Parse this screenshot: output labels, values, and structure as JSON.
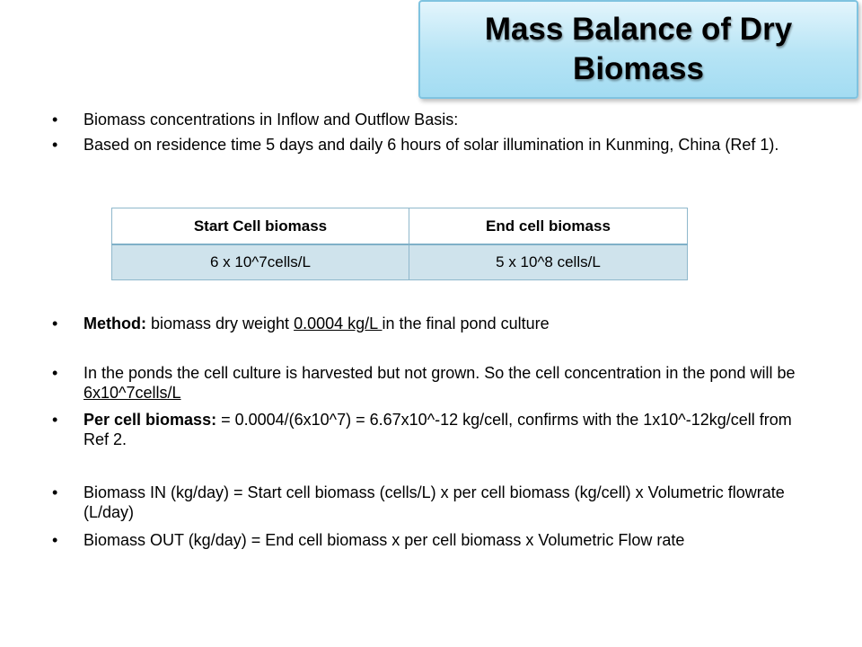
{
  "title": "Mass Balance of Dry Biomass",
  "bullets": {
    "b1": "Biomass concentrations in Inflow and Outflow Basis:",
    "b2": "Based on residence time 5 days and daily 6 hours of solar illumination in Kunming, China (Ref 1).",
    "b3_bold": "Method:",
    "b3_pre": " biomass dry weight ",
    "b3_u": "0.0004 kg/L ",
    "b3_post": " in the final pond culture",
    "b4_pre": "In the ponds the cell culture is harvested but not grown. So the cell concentration in the pond will be ",
    "b4_u": "6x10^7cells/L",
    "b5_bold": "Per cell biomass:",
    "b5_rest": " = 0.0004/(6x10^7) = 6.67x10^-12 kg/cell, confirms with the 1x10^-12kg/cell from Ref 2.",
    "b6": "Biomass IN (kg/day) = Start cell biomass (cells/L) x per cell biomass (kg/cell) x Volumetric flowrate (L/day)",
    "b7": "Biomass OUT (kg/day) = End cell biomass x per cell biomass x Volumetric Flow rate"
  },
  "table": {
    "headers": [
      "Start Cell biomass",
      "End cell biomass"
    ],
    "rows": [
      [
        "6 x 10^7cells/L",
        "5 x 10^8 cells/L"
      ]
    ]
  },
  "colors": {
    "title_bg": "#b6e4f5",
    "table_cell_bg": "#cfe3ec"
  }
}
